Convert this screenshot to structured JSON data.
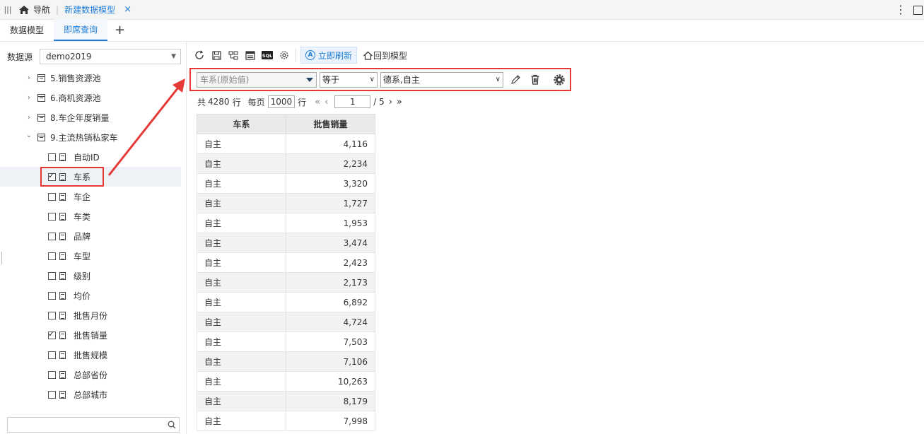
{
  "topbar": {
    "menu_icon": "menu-icon",
    "home_label": "导航",
    "active_tab": "新建数据模型",
    "close_glyph": "×"
  },
  "subtabs": [
    {
      "label": "数据模型",
      "active": false
    },
    {
      "label": "即席查询",
      "active": true
    }
  ],
  "subtab_add": "+",
  "datasource": {
    "label": "数据源",
    "value": "demo2019"
  },
  "tree": [
    {
      "type": "table",
      "label": "5.销售资源池",
      "expanded": false
    },
    {
      "type": "table",
      "label": "6.商机资源池",
      "expanded": false
    },
    {
      "type": "table",
      "label": "8.车企年度销量",
      "expanded": false
    },
    {
      "type": "table",
      "label": "9.主流热销私家车",
      "expanded": true
    },
    {
      "type": "field",
      "label": "自动ID",
      "checked": false
    },
    {
      "type": "field",
      "label": "车系",
      "checked": true,
      "highlight": true
    },
    {
      "type": "field",
      "label": "车企",
      "checked": false
    },
    {
      "type": "field",
      "label": "车类",
      "checked": false
    },
    {
      "type": "field",
      "label": "品牌",
      "checked": false
    },
    {
      "type": "field",
      "label": "车型",
      "checked": false
    },
    {
      "type": "field",
      "label": "级别",
      "checked": false
    },
    {
      "type": "field",
      "label": "均价",
      "checked": false
    },
    {
      "type": "field",
      "label": "批售月份",
      "checked": false
    },
    {
      "type": "field",
      "label": "批售销量",
      "checked": true
    },
    {
      "type": "field",
      "label": "批售规模",
      "checked": false
    },
    {
      "type": "field",
      "label": "总部省份",
      "checked": false
    },
    {
      "type": "field",
      "label": "总部城市",
      "checked": false
    }
  ],
  "toolbar": {
    "refresh_now": "立即刷新",
    "back_to_model": "回到模型",
    "sql_label": "SQL"
  },
  "filter": {
    "field": "车系(原始值)",
    "operator": "等于",
    "value": "德系,自主"
  },
  "pager": {
    "total_prefix": "共",
    "total": "4280",
    "total_suffix": "行",
    "per_page_label": "每页",
    "per_page": "1000",
    "per_page_suffix": "行",
    "current_page": "1",
    "page_of": "/ 5"
  },
  "table": {
    "headers": [
      "车系",
      "批售销量"
    ],
    "rows": [
      [
        "自主",
        "4,116"
      ],
      [
        "自主",
        "2,234"
      ],
      [
        "自主",
        "3,320"
      ],
      [
        "自主",
        "1,727"
      ],
      [
        "自主",
        "1,953"
      ],
      [
        "自主",
        "3,474"
      ],
      [
        "自主",
        "2,423"
      ],
      [
        "自主",
        "2,173"
      ],
      [
        "自主",
        "6,892"
      ],
      [
        "自主",
        "4,724"
      ],
      [
        "自主",
        "7,503"
      ],
      [
        "自主",
        "7,106"
      ],
      [
        "自主",
        "10,263"
      ],
      [
        "自主",
        "8,179"
      ],
      [
        "自主",
        "7,998"
      ]
    ]
  },
  "colors": {
    "accent": "#1e7dd6",
    "annotation": "#e53935"
  }
}
